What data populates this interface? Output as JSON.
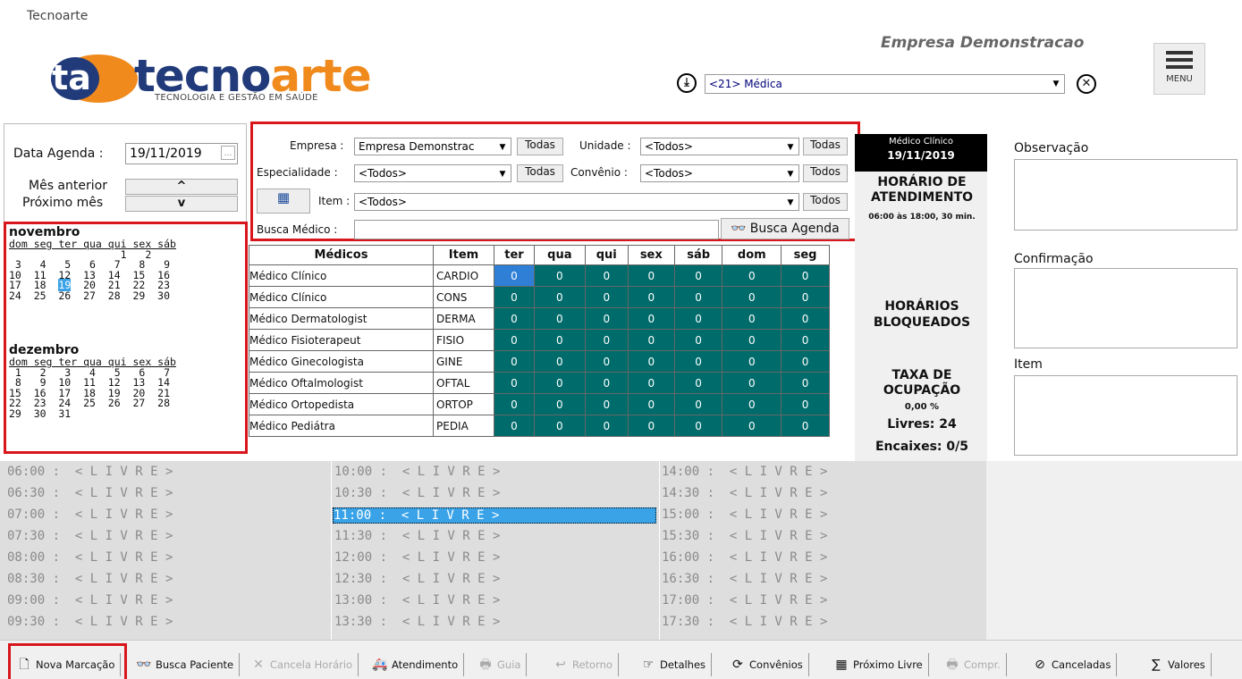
{
  "app_title": "Tecnoarte",
  "logo": {
    "word_a": "tecno",
    "word_b": "arte",
    "tagline": "TECNOLOGIA E GESTÃO EM SAÚDE",
    "mark": "ta"
  },
  "header": {
    "empresa": "Empresa Demonstracao",
    "medico_select": "<21> Médica",
    "menu_label": "MENU"
  },
  "left": {
    "data_label": "Data Agenda :",
    "data_value": "19/11/2019",
    "mes_anterior": "Mês anterior",
    "proximo_mes": "Próximo mês",
    "up": "^",
    "down": "v",
    "nov": {
      "title": "novembro",
      "dow": "dom seg ter qua qui sex sáb",
      "weeks": [
        "                  1   2",
        " 3   4   5   6   7   8   9",
        "10  11  12  13  14  15  16",
        "17  18  19  20  21  22  23",
        "24  25  26  27  28  29  30"
      ]
    },
    "dez": {
      "title": "dezembro",
      "dow": "dom seg ter qua qui sex sáb",
      "weeks": [
        " 1   2   3   4   5   6   7",
        " 8   9  10  11  12  13  14",
        "15  16  17  18  19  20  21",
        "22  23  24  25  26  27  28",
        "29  30  31"
      ]
    }
  },
  "filters": {
    "empresa_label": "Empresa :",
    "empresa_value": "Empresa Demonstrac",
    "unidade_label": "Unidade :",
    "unidade_value": "<Todos>",
    "especialidade_label": "Especialidade :",
    "especialidade_value": "<Todos>",
    "convenio_label": "Convênio :",
    "convenio_value": "<Todos>",
    "item_label": "Item :",
    "item_value": "<Todos>",
    "busca_label": "Busca Médico :",
    "busca_value": "",
    "todas": "Todas",
    "todos": "Todos",
    "busca_agenda": "Busca Agenda"
  },
  "table": {
    "headers": [
      "Médicos",
      "Item",
      "ter",
      "qua",
      "qui",
      "sex",
      "sáb",
      "dom",
      "seg"
    ],
    "rows": [
      {
        "med": "Médico Clínico",
        "item": "CARDIO",
        "v": [
          "0",
          "0",
          "0",
          "0",
          "0",
          "0",
          "0"
        ]
      },
      {
        "med": "Médico Clínico",
        "item": "CONS",
        "v": [
          "0",
          "0",
          "0",
          "0",
          "0",
          "0",
          "0"
        ]
      },
      {
        "med": "Médico Dermatologist",
        "item": "DERMA",
        "v": [
          "0",
          "0",
          "0",
          "0",
          "0",
          "0",
          "0"
        ]
      },
      {
        "med": "Médico Fisioterapeut",
        "item": "FISIO",
        "v": [
          "0",
          "0",
          "0",
          "0",
          "0",
          "0",
          "0"
        ]
      },
      {
        "med": "Médico Ginecologista",
        "item": "GINE",
        "v": [
          "0",
          "0",
          "0",
          "0",
          "0",
          "0",
          "0"
        ]
      },
      {
        "med": "Médico Oftalmologist",
        "item": "OFTAL",
        "v": [
          "0",
          "0",
          "0",
          "0",
          "0",
          "0",
          "0"
        ]
      },
      {
        "med": "Médico Ortopedista",
        "item": "ORTOP",
        "v": [
          "0",
          "0",
          "0",
          "0",
          "0",
          "0",
          "0"
        ]
      },
      {
        "med": "Médico Pediátra",
        "item": "PEDIA",
        "v": [
          "0",
          "0",
          "0",
          "0",
          "0",
          "0",
          "0"
        ]
      }
    ]
  },
  "info": {
    "medico": "Médico Clínico",
    "data": "19/11/2019",
    "horario_title": "HORÁRIO DE ATENDIMENTO",
    "horario": "06:00 às 18:00, 30 min.",
    "bloqueados": "HORÁRIOS BLOQUEADOS",
    "taxa_title": "TAXA DE OCUPAÇÃO",
    "taxa": "0,00 %",
    "livres": "Livres: 24",
    "encaixes": "Encaixes: 0/5"
  },
  "notes": {
    "observacao": "Observação",
    "confirmacao": "Confirmação",
    "item": "Item"
  },
  "slots": {
    "col1": [
      "06:00 :  < L I V R E >",
      "06:30 :  < L I V R E >",
      "07:00 :  < L I V R E >",
      "07:30 :  < L I V R E >",
      "08:00 :  < L I V R E >",
      "08:30 :  < L I V R E >",
      "09:00 :  < L I V R E >",
      "09:30 :  < L I V R E >"
    ],
    "col2": [
      "10:00 :  < L I V R E >",
      "10:30 :  < L I V R E >",
      "11:00 :  < L I V R E >",
      "11:30 :  < L I V R E >",
      "12:00 :  < L I V R E >",
      "12:30 :  < L I V R E >",
      "13:00 :  < L I V R E >",
      "13:30 :  < L I V R E >"
    ],
    "col3": [
      "14:00 :  < L I V R E >",
      "14:30 :  < L I V R E >",
      "15:00 :  < L I V R E >",
      "15:30 :  < L I V R E >",
      "16:00 :  < L I V R E >",
      "16:30 :  < L I V R E >",
      "17:00 :  < L I V R E >",
      "17:30 :  < L I V R E >"
    ]
  },
  "toolbar": [
    {
      "label": "Nova Marcação",
      "icon": "document-icon"
    },
    {
      "label": "Busca Paciente",
      "icon": "binoculars-icon"
    },
    {
      "label": "Cancela Horário",
      "icon": "x-icon"
    },
    {
      "label": "Atendimento",
      "icon": "ambulance-icon"
    },
    {
      "label": "Guia",
      "icon": "printer-icon"
    },
    {
      "label": "Retorno",
      "icon": "return-icon"
    },
    {
      "label": "Detalhes",
      "icon": "hand-pointer-icon"
    },
    {
      "label": "Convênios",
      "icon": "refresh-icon"
    },
    {
      "label": "Próximo Livre",
      "icon": "calendar-icon"
    },
    {
      "label": "Compr.",
      "icon": "printer-icon"
    },
    {
      "label": "Canceladas",
      "icon": "cancel-icon"
    },
    {
      "label": "Valores",
      "icon": "sigma-icon"
    }
  ],
  "colors": {
    "teal": "#006b6b",
    "highlight": "#3aa3e8",
    "red_frame": "#d8161b",
    "brand_blue": "#213a7a",
    "brand_orange": "#f08a1c"
  }
}
